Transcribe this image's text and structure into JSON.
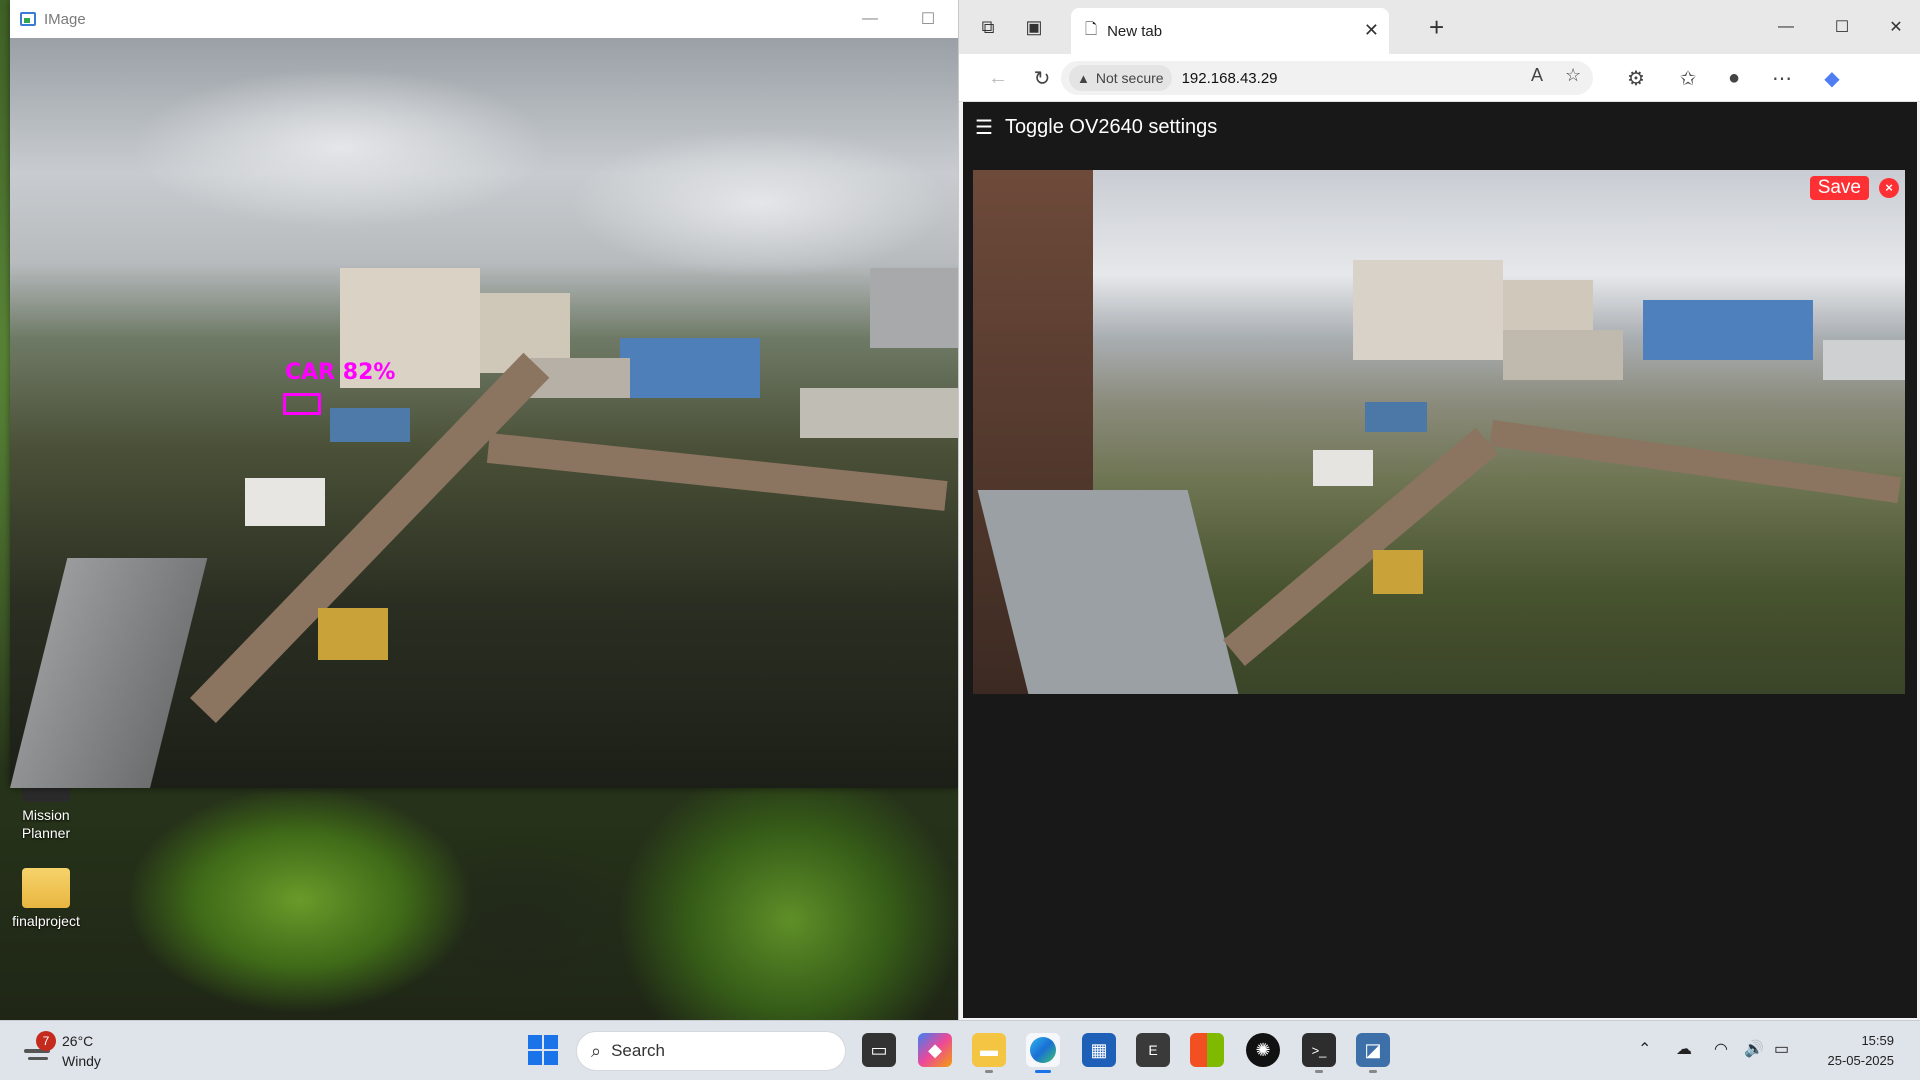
{
  "desktop": {
    "icons": [
      {
        "label": "Mission\nPlanner"
      },
      {
        "label": "finalproject"
      }
    ]
  },
  "image_window": {
    "title": "IMage",
    "detection": {
      "label": "CAR 82%"
    },
    "minimize": "—",
    "maximize": "☐"
  },
  "browser": {
    "tab_title": "New tab",
    "security_label": "Not secure",
    "url": "192.168.43.29",
    "page": {
      "header": "Toggle OV2640 settings",
      "save_label": "Save",
      "close_label": "×"
    },
    "window_controls": {
      "minimize": "—",
      "maximize": "☐",
      "close": "✕"
    }
  },
  "taskbar": {
    "weather": {
      "temp": "26°C",
      "condition": "Windy",
      "badge": "7"
    },
    "search_placeholder": "Search",
    "clock": {
      "time": "15:59",
      "date": "25-05-2025"
    },
    "apps": [
      "task-view",
      "copilot",
      "file-explorer",
      "edge",
      "store",
      "epic",
      "office",
      "chatgpt",
      "terminal",
      "python"
    ]
  }
}
